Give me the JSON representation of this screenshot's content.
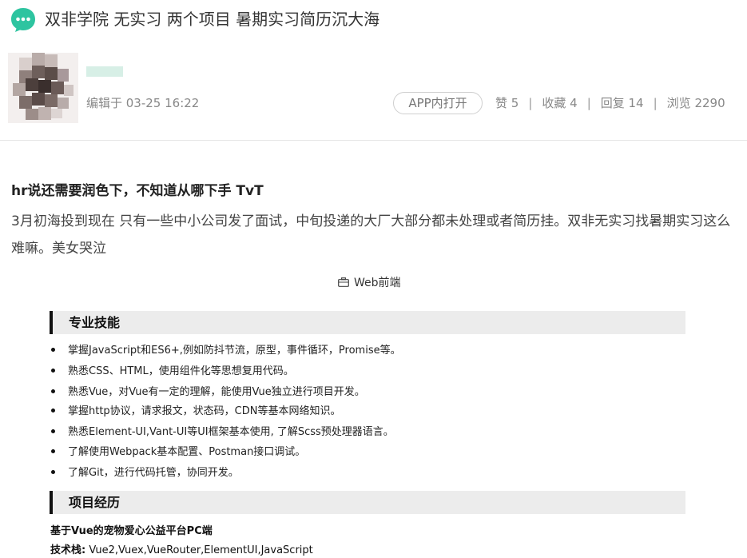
{
  "post": {
    "title": "双非学院 无实习 两个项目 暑期实习简历沉大海",
    "edited_time": "编辑于 03-25 16:22",
    "app_button": "APP内打开",
    "stats": {
      "likes": "赞 5",
      "favorites": "收藏 4",
      "replies": "回复 14",
      "views": "浏览 2290"
    },
    "separator": "|",
    "heading": "hr说还需要润色下，不知道从哪下手 TvT",
    "body": "3月初海投到现在 只有一些中小公司发了面试，中旬投递的大厂大部分都未处理或者简历挂。双非无实习找暑期实习这么难嘛。美女哭泣"
  },
  "resume": {
    "job_target": "Web前端",
    "skills_title": "专业技能",
    "skills": [
      "掌握JavaScript和ES6+,例如防抖节流，原型，事件循环，Promise等。",
      "熟悉CSS、HTML，使用组件化等思想复用代码。",
      "熟悉Vue，对Vue有一定的理解，能使用Vue独立进行项目开发。",
      "掌握http协议，请求报文，状态码，CDN等基本网络知识。",
      "熟悉Element-UI,Vant-UI等UI框架基本使用, 了解Scss预处理器语言。",
      "了解使用Webpack基本配置、Postman接口调试。",
      "了解Git，进行代码托管，协同开发。"
    ],
    "projects_title": "项目经历",
    "project": {
      "name": "基于Vue的宠物爱心公益平台PC端",
      "tech_label": "技术栈:",
      "tech_value": " Vue2,Vuex,VueRouter,ElementUI,JavaScript"
    }
  },
  "colors": {
    "brand": "#2ec4a0",
    "username_placeholder": "#d7efe6"
  },
  "icons": [
    "chat-bubble-icon",
    "briefcase-icon",
    "bullet-icon"
  ]
}
